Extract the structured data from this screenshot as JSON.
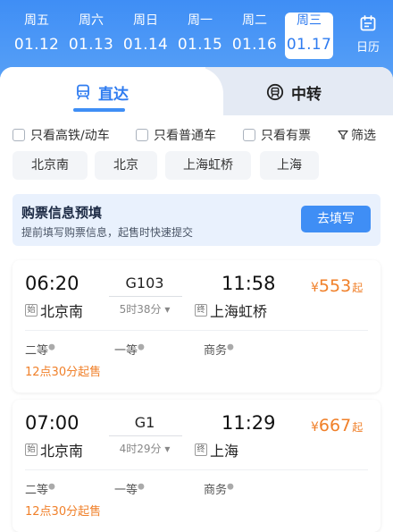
{
  "date_bar": {
    "days": [
      {
        "weekday": "周五",
        "date": "01.12"
      },
      {
        "weekday": "周六",
        "date": "01.13"
      },
      {
        "weekday": "周日",
        "date": "01.14"
      },
      {
        "weekday": "周一",
        "date": "01.15"
      },
      {
        "weekday": "周二",
        "date": "01.16"
      },
      {
        "weekday": "周三",
        "date": "01.17"
      }
    ],
    "selected_date": "01.17",
    "calendar_label": "日历"
  },
  "tabs": {
    "direct": "直达",
    "transfer": "中转",
    "active": "直达"
  },
  "filters": {
    "high_speed": "只看高铁/动车",
    "regular": "只看普通车",
    "available": "只看有票",
    "filter": "筛选"
  },
  "stations": [
    "北京南",
    "北京",
    "上海虹桥",
    "上海"
  ],
  "banner": {
    "title": "购票信息预填",
    "desc": "提前填写购票信息，起售时快速提交",
    "button": "去填写"
  },
  "trains": [
    {
      "depart_time": "06:20",
      "code": "G103",
      "arrive_time": "11:58",
      "duration": "5时38分",
      "depart_tag": "始",
      "depart_station": "北京南",
      "arrive_tag": "终",
      "arrive_station": "上海虹桥",
      "currency": "¥",
      "price": "553",
      "price_suffix": "起",
      "seats": [
        "二等",
        "一等",
        "商务"
      ],
      "sale_time": "12点30分起售"
    },
    {
      "depart_time": "07:00",
      "code": "G1",
      "arrive_time": "11:29",
      "duration": "4时29分",
      "depart_tag": "始",
      "depart_station": "北京南",
      "arrive_tag": "终",
      "arrive_station": "上海",
      "currency": "¥",
      "price": "667",
      "price_suffix": "起",
      "seats": [
        "二等",
        "一等",
        "商务"
      ],
      "sale_time": "12点30分起售"
    }
  ],
  "colors": {
    "primary": "#3f8ef5",
    "price": "#f0802a"
  }
}
